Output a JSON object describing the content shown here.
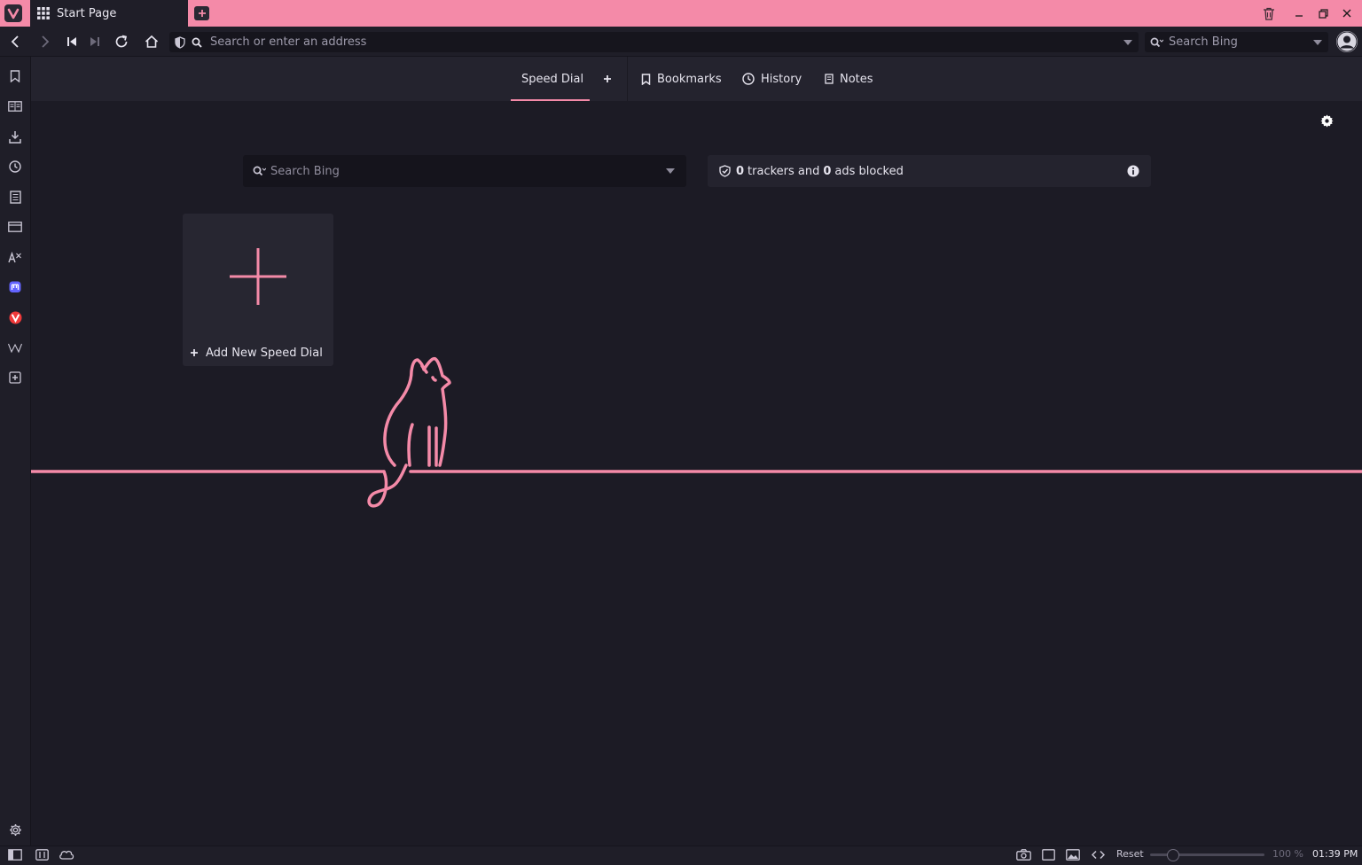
{
  "colors": {
    "accent": "#f48aa8",
    "background": "#1c1b25",
    "chrome": "#1f1e28"
  },
  "tab": {
    "title": "Start Page",
    "icon": "grid-icon"
  },
  "address_bar": {
    "placeholder": "Search or enter an address"
  },
  "search_box": {
    "placeholder": "Search Bing"
  },
  "start_nav": {
    "speed_dial": "Speed Dial",
    "bookmarks": "Bookmarks",
    "history": "History",
    "notes": "Notes"
  },
  "content": {
    "search_placeholder": "Search Bing",
    "trackers": {
      "tracker_count": "0",
      "middle": "trackers and",
      "ad_count": "0",
      "suffix": "ads blocked"
    },
    "speed_dial_add_label": "Add New Speed Dial"
  },
  "sidebar_icons": [
    "bookmark-icon",
    "reading-list-icon",
    "downloads-icon",
    "history-icon",
    "notes-icon",
    "window-icon",
    "translate-icon",
    "mastodon-icon",
    "vivaldi-icon",
    "wikipedia-icon",
    "add-panel-icon"
  ],
  "status": {
    "reset_label": "Reset",
    "zoom": "100 %",
    "clock": "01:39 PM"
  }
}
